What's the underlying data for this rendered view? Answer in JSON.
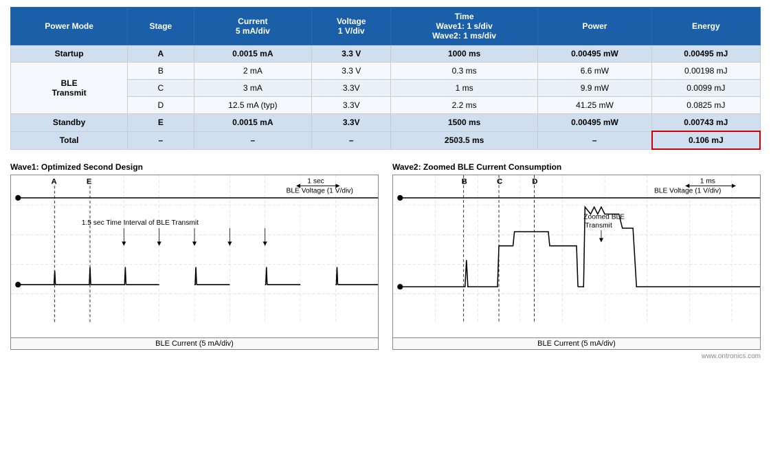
{
  "table": {
    "headers": [
      "Power Mode",
      "Stage",
      "Current\n5 mA/div",
      "Voltage\n1 V/div",
      "Time\nWave1: 1 s/div\nWave2: 1 ms/div",
      "Power",
      "Energy"
    ],
    "rows": [
      {
        "mode": "Startup",
        "stage": "A",
        "current": "0.0015 mA",
        "voltage": "3.3 V",
        "time": "1000 ms",
        "power": "0.00495 mW",
        "energy": "0.00495 mJ",
        "rowType": "single"
      },
      {
        "mode": "BLE\nTransmit",
        "stage": "B",
        "current": "2 mA",
        "voltage": "3.3 V",
        "time": "0.3 ms",
        "power": "6.6 mW",
        "energy": "0.00198 mJ",
        "rowType": "group-first"
      },
      {
        "mode": "",
        "stage": "C",
        "current": "3 mA",
        "voltage": "3.3V",
        "time": "1 ms",
        "power": "9.9 mW",
        "energy": "0.0099 mJ",
        "rowType": "group-middle"
      },
      {
        "mode": "",
        "stage": "D",
        "current": "12.5 mA (typ)",
        "voltage": "3.3V",
        "time": "2.2 ms",
        "power": "41.25 mW",
        "energy": "0.0825 mJ",
        "rowType": "group-last"
      },
      {
        "mode": "Standby",
        "stage": "E",
        "current": "0.0015 mA",
        "voltage": "3.3V",
        "time": "1500 ms",
        "power": "0.00495 mW",
        "energy": "0.00743 mJ",
        "rowType": "single"
      },
      {
        "mode": "Total",
        "stage": "–",
        "current": "–",
        "voltage": "–",
        "time": "2503.5 ms",
        "power": "–",
        "energy": "0.106 mJ",
        "rowType": "total",
        "energyHighlight": true
      }
    ]
  },
  "wave1": {
    "title": "Wave1: Optimized Second Design",
    "label_top_voltage": "BLE Voltage (1 V/div)",
    "label_bottom_current": "BLE Current (5 mA/div)",
    "label_time": "1 sec",
    "annotation": "1.5 sec Time Interval of BLE Transmit",
    "markers": [
      "A",
      "E"
    ],
    "time_arrow": "1 sec"
  },
  "wave2": {
    "title": "Wave2: Zoomed BLE Current Consumption",
    "label_top_voltage": "BLE Voltage (1 V/div)",
    "label_bottom_current": "BLE Current (5 mA/div)",
    "label_time": "1 ms",
    "annotation": "Zoomed BLE\nTransmit",
    "markers": [
      "B",
      "C",
      "D"
    ],
    "time_arrow": "1 ms"
  },
  "watermark": "www.ontronics.com"
}
